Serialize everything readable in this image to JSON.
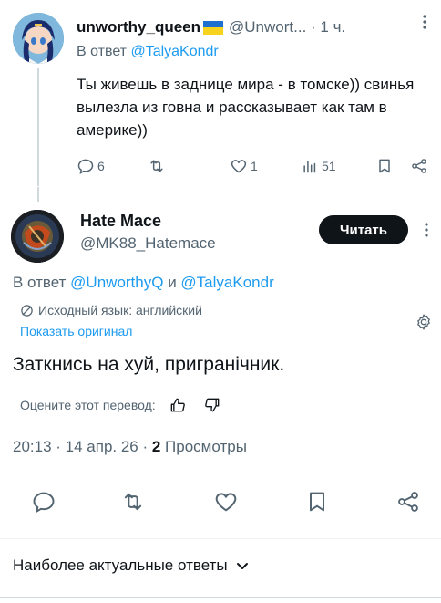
{
  "reply": {
    "author_name": "unworthy_queen",
    "handle_time": "@Unwort... · 1 ч.",
    "replying_to_prefix": "В ответ ",
    "replying_to_user": "@TalyaKondr",
    "text": "Ты живешь в заднице мира - в томске)) свинья вылезла из говна и рассказывает как там в америке))",
    "stats": {
      "replies": "6",
      "likes": "1",
      "views": "51"
    }
  },
  "main": {
    "author_name": "Hate Mace",
    "handle": "@MK88_Hatemace",
    "follow_label": "Читать",
    "replying_to_prefix": "В ответ ",
    "replying_to_user1": "@UnworthyQ",
    "replying_to_and": " и ",
    "replying_to_user2": "@TalyaKondr",
    "original_language": "Исходный язык: английский",
    "show_original": "Показать оригинал",
    "text": "Заткнись на хуй, пригранічник.",
    "rate_translation": "Оцените этот перевод:",
    "timestamp": "20:13 · 14 апр. 26 · ",
    "views_count": "2",
    "views_label": " Просмотры"
  },
  "replies_header": {
    "label": "Наиболее актуальные ответы"
  },
  "colors": {
    "accent": "#1d9bf0",
    "text": "#0f1419",
    "secondary": "#536471",
    "flag_blue": "#1f6fd1",
    "flag_yellow": "#f7d21e"
  }
}
